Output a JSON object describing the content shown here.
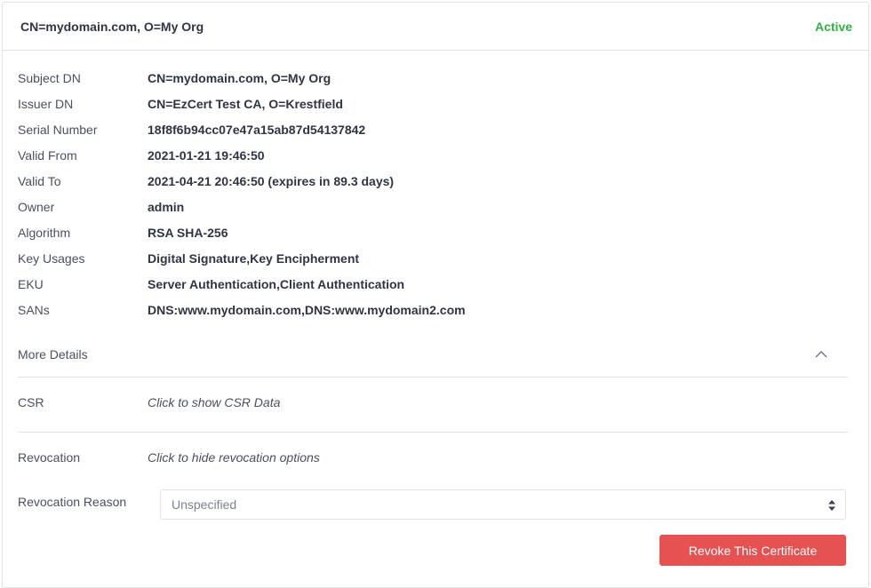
{
  "card": {
    "title": "CN=mydomain.com, O=My Org",
    "status": "Active",
    "status_color": "#2fb344"
  },
  "details": [
    {
      "label": "Subject DN",
      "value": "CN=mydomain.com, O=My Org"
    },
    {
      "label": "Issuer DN",
      "value": "CN=EzCert Test CA, O=Krestfield"
    },
    {
      "label": "Serial Number",
      "value": "18f8f6b94cc07e47a15ab87d54137842"
    },
    {
      "label": "Valid From",
      "value": "2021-01-21 19:46:50"
    },
    {
      "label": "Valid To",
      "value": "2021-04-21 20:46:50 (expires in 89.3 days)"
    },
    {
      "label": "Owner",
      "value": "admin"
    },
    {
      "label": "Algorithm",
      "value": "RSA SHA-256"
    },
    {
      "label": "Key Usages",
      "value": "Digital Signature,Key Encipherment"
    },
    {
      "label": "EKU",
      "value": "Server Authentication,Client Authentication"
    },
    {
      "label": "SANs",
      "value": "DNS:www.mydomain.com,DNS:www.mydomain2.com"
    }
  ],
  "more_details": {
    "label": "More Details",
    "icon": "chevron-up-icon"
  },
  "csr": {
    "label": "CSR",
    "link": "Click to show CSR Data"
  },
  "revocation": {
    "label": "Revocation",
    "link": "Click to hide revocation options",
    "reason_label": "Revocation Reason",
    "reason_selected": "Unspecified",
    "revoke_button": "Revoke This Certificate",
    "revoke_color": "#e65252"
  }
}
